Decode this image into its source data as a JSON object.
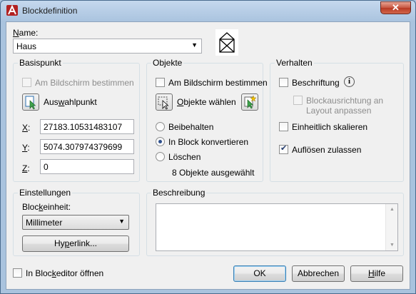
{
  "window": {
    "title": "Blockdefinition",
    "close_label": "✕"
  },
  "name": {
    "label": "Name:",
    "value": "Haus"
  },
  "basispunkt": {
    "title": "Basispunkt",
    "screen_label": "Am Bildschirm bestimmen",
    "pick_label": "Auswahlpunkt",
    "x_label": "X:",
    "x_value": "27183.10531483107",
    "y_label": "Y:",
    "y_value": "5074.307974379699",
    "z_label": "Z:",
    "z_value": "0"
  },
  "objekte": {
    "title": "Objekte",
    "screen_label": "Am Bildschirm bestimmen",
    "select_label": "Objekte wählen",
    "options": [
      "Beibehalten",
      "In Block konvertieren",
      "Löschen"
    ],
    "selected": "In Block konvertieren",
    "status": "8 Objekte ausgewählt"
  },
  "verhalten": {
    "title": "Verhalten",
    "annotative_label": "Beschriftung",
    "orientation_line1": "Blockausrichtung an",
    "orientation_line2": "Layout anpassen",
    "uniform_label": "Einheitlich skalieren",
    "explode_label": "Auflösen zulassen",
    "explode_checked": true
  },
  "einstellungen": {
    "title": "Einstellungen",
    "unit_label": "Blockeinheit:",
    "unit_value": "Millimeter",
    "hyperlink_label": "Hyperlink..."
  },
  "beschreibung": {
    "title": "Beschreibung",
    "value": ""
  },
  "footer": {
    "editor_label": "In Blockeditor öffnen",
    "ok_label": "OK",
    "cancel_label": "Abbrechen",
    "help_label": "Hilfe"
  }
}
